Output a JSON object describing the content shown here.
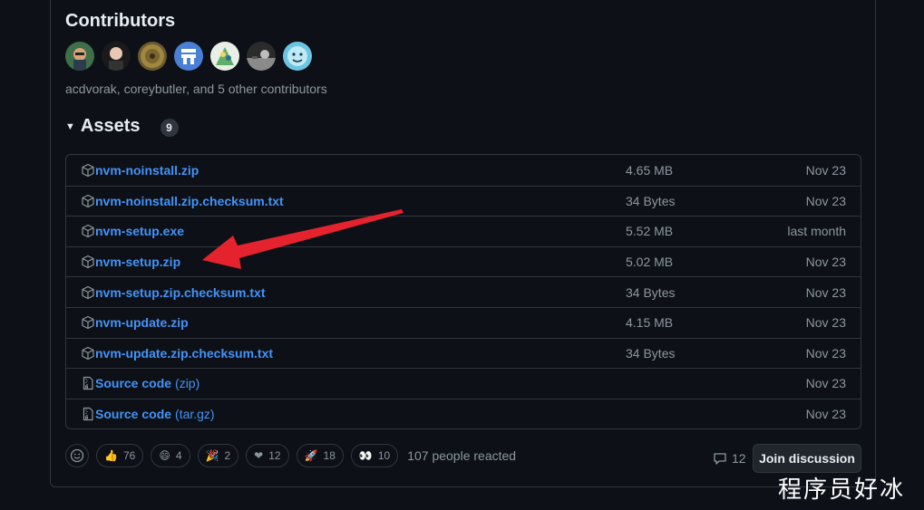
{
  "contributors": {
    "title": "Contributors",
    "summary": "acdvorak, coreybutler, and 5 other contributors"
  },
  "assets": {
    "title": "Assets",
    "count": "9",
    "rows": [
      {
        "name": "nvm-noinstall.zip",
        "suffix": "",
        "size": "4.65 MB",
        "date": "Nov 23",
        "icon": "package-icon"
      },
      {
        "name": "nvm-noinstall.zip.checksum.txt",
        "suffix": "",
        "size": "34 Bytes",
        "date": "Nov 23",
        "icon": "package-icon"
      },
      {
        "name": "nvm-setup.exe",
        "suffix": "",
        "size": "5.52 MB",
        "date": "last month",
        "icon": "package-icon"
      },
      {
        "name": "nvm-setup.zip",
        "suffix": "",
        "size": "5.02 MB",
        "date": "Nov 23",
        "icon": "package-icon"
      },
      {
        "name": "nvm-setup.zip.checksum.txt",
        "suffix": "",
        "size": "34 Bytes",
        "date": "Nov 23",
        "icon": "package-icon"
      },
      {
        "name": "nvm-update.zip",
        "suffix": "",
        "size": "4.15 MB",
        "date": "Nov 23",
        "icon": "package-icon"
      },
      {
        "name": "nvm-update.zip.checksum.txt",
        "suffix": "",
        "size": "34 Bytes",
        "date": "Nov 23",
        "icon": "package-icon"
      },
      {
        "name": "Source code",
        "suffix": "(zip)",
        "size": "",
        "date": "Nov 23",
        "icon": "file-zip-icon"
      },
      {
        "name": "Source code",
        "suffix": "(tar.gz)",
        "size": "",
        "date": "Nov 23",
        "icon": "file-zip-icon"
      }
    ]
  },
  "reactions": {
    "items": [
      {
        "emoji": "👍",
        "count": "76"
      },
      {
        "emoji": "😄",
        "count": "4"
      },
      {
        "emoji": "🎉",
        "count": "2"
      },
      {
        "emoji": "❤",
        "count": "12"
      },
      {
        "emoji": "🚀",
        "count": "18"
      },
      {
        "emoji": "👀",
        "count": "10"
      }
    ],
    "summary": "107 people reacted"
  },
  "discussion": {
    "comment_count": "12",
    "join_label": "Join discussion"
  },
  "watermark": "程序员好冰",
  "colors": {
    "background": "#0d1117",
    "link": "#4493f8",
    "muted": "#8d96a0",
    "border": "#30363d",
    "annotation_arrow": "#e5232e"
  }
}
